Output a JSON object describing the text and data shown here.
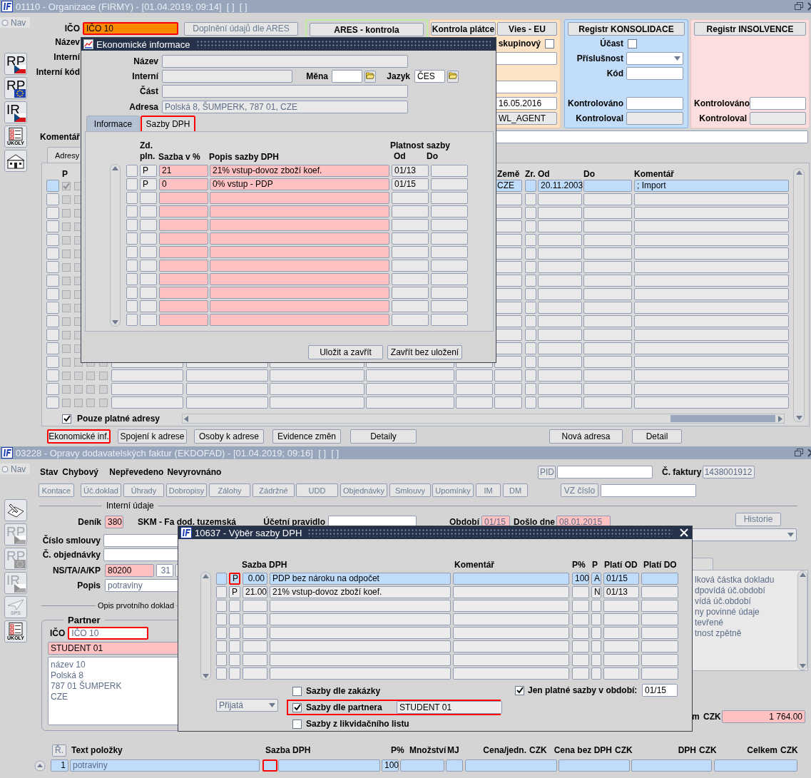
{
  "org_window": {
    "title": "01110 - Organizace (FIRMY) - [01.04.2019; 09:14]  [ ]  [ ]",
    "nav": "Nav",
    "toolbar": [
      {
        "kind": "cz-badge",
        "label": "RP",
        "disabled": false
      },
      {
        "kind": "eu-badge",
        "label": "RP",
        "disabled": false
      },
      {
        "kind": "cz-badge",
        "label": "IR",
        "disabled": false
      },
      {
        "kind": "tasks",
        "label": "ÚKOLY",
        "disabled": false
      },
      {
        "kind": "building",
        "disabled": false
      }
    ],
    "ico": {
      "label": "IČO",
      "value": "IČO 10",
      "highlighted": true
    },
    "labels": [
      "Název",
      "Interní",
      "Interní kód"
    ],
    "fill_button": "Doplnění údajů dle ARES",
    "ares_button": "ARES - kontrola",
    "payer": {
      "buttons": [
        "Kontrola plátce",
        "Vies - EU"
      ],
      "group_label": "skupinový",
      "group_checked": false,
      "checked_date": "16.05.2016",
      "checked_by": "WL_AGENT"
    },
    "consolidation": {
      "button": "Registr KONSOLIDACE",
      "participation": "Účast",
      "participation_checked": false,
      "membership": "Příslušnost",
      "code": "Kód",
      "checked_label": "Kontrolováno",
      "checked_by_label": "Kontroloval"
    },
    "insolvency": {
      "button": "Registr INSOLVENCE",
      "checked_label": "Kontrolováno",
      "checked_by_label": "Kontroloval"
    },
    "comment_label": "Komentář",
    "addresses_tab": "Adresy",
    "address_columns": {
      "p": "P",
      "country": "Země",
      "zr": "Zr.",
      "from": "Od",
      "to": "Do",
      "comment": "Komentář"
    },
    "address_rows": [
      {
        "selected": true,
        "p_checked": true,
        "country": "CZE",
        "from": "20.11.2003",
        "comment": "; Import"
      }
    ],
    "valid_only": {
      "label": "Pouze platné adresy",
      "checked": true
    },
    "buttons": [
      {
        "label": "Ekonomické inf.",
        "highlighted": true
      },
      {
        "label": "Spojení k adrese",
        "highlighted": false
      },
      {
        "label": "Osoby k adrese",
        "highlighted": false
      },
      {
        "label": "Evidence změn",
        "highlighted": false
      },
      {
        "label": "Detaily",
        "highlighted": false
      },
      {
        "label": "Nová adresa",
        "highlighted": false
      },
      {
        "label": "Detail",
        "highlighted": false
      }
    ]
  },
  "econ_dialog": {
    "title": "Ekonomické informace",
    "name_label": "Název",
    "internal_label": "Interní",
    "currency_label": "Měna",
    "language_label": "Jazyk",
    "language": "ČES",
    "part_label": "Část",
    "address_label": "Adresa",
    "address": "Polská 8, ŠUMPERK, 787 01, CZE",
    "tabs": [
      {
        "label": "Informace",
        "selected": false,
        "highlighted": false
      },
      {
        "label": "Sazby DPH",
        "selected": true,
        "highlighted": true
      }
    ],
    "columns": {
      "taxable": "Zd. pln.",
      "rate": "Sazba v %",
      "description": "Popis sazby DPH",
      "validity": "Platnost sazby",
      "from": "Od",
      "to": "Do"
    },
    "rows": [
      {
        "taxable": "P",
        "rate": "21",
        "description": "21% vstup-dovoz zboží koef.",
        "from": "01/13"
      },
      {
        "taxable": "P",
        "rate": "0",
        "description": "0% vstup - PDP",
        "from": "01/15"
      }
    ],
    "buttons": [
      "Uložit a zavřít",
      "Zavřít bez uložení"
    ]
  },
  "invoice_window": {
    "title": "03228 - Opravy dodavatelských faktur (EKDOFAD) - [01.04.2019; 09:16]  [ ]  [ ]",
    "nav": "Nav",
    "toolbar": [
      {
        "kind": "signature",
        "disabled": false
      },
      {
        "kind": "cz-badge",
        "label": "RP",
        "disabled": true
      },
      {
        "kind": "eu-badge",
        "label": "RP",
        "disabled": true
      },
      {
        "kind": "cz-badge",
        "label": "IR",
        "disabled": true
      },
      {
        "kind": "plane",
        "label": "SPS",
        "disabled": true
      },
      {
        "kind": "tasks",
        "label": "ÚKOLY",
        "disabled": false
      }
    ],
    "status": {
      "label": "Stav",
      "value": "Chybový",
      "transfer": "Nepřevedeno",
      "balance": "Nevyrovnáno"
    },
    "pid_button": "PID",
    "invoice_label": "Č. faktury",
    "invoice_no": "1438001912",
    "actions": [
      {
        "label": "Kontace",
        "disabled": true
      },
      {
        "label": "Úč.doklad",
        "disabled": true
      },
      {
        "label": "Úhrady",
        "disabled": true
      },
      {
        "label": "Dobropisy",
        "disabled": true
      },
      {
        "label": "Zálohy",
        "disabled": true
      },
      {
        "label": "Zádržné",
        "disabled": true
      },
      {
        "label": "UDD",
        "disabled": true
      },
      {
        "label": "Objednávky",
        "disabled": true
      },
      {
        "label": "Smlouvy",
        "disabled": true
      },
      {
        "label": "Upomínky",
        "disabled": true
      },
      {
        "label": "IM",
        "disabled": true
      },
      {
        "label": "DM",
        "disabled": true
      }
    ],
    "vz_button": "VZ číslo",
    "internal_section": "Interní údaje",
    "journal_label": "Deník",
    "journal": "380",
    "journal_name": "SKM - Fa dod. tuzemská",
    "rule_label": "Účetní pravidlo",
    "period_label": "Období",
    "period": "01/15",
    "received_label": "Došlo dne",
    "received": "08.01.2015",
    "history_button": "Historie",
    "contract_label": "Číslo smlouvy",
    "order_label": "Č. objednávky",
    "ns_label": "NS/TA/A/KP",
    "ns": "80200",
    "ta": "31",
    "desc_label": "Popis",
    "desc": "potraviny",
    "original_section": "Opis prvotního doklad",
    "partner": {
      "title": "Partner",
      "ico_label": "IČO",
      "ico": "IČO 10",
      "ico_highlighted": true,
      "name": "STUDENT 01",
      "address": [
        "název 10",
        "Polská 8",
        "787 01 ŠUMPERK",
        "CZE"
      ]
    },
    "messages": [
      "lková částka dokladu",
      "dpovídá úč.období",
      "vídá úč.období",
      "ny povinné údaje",
      "tevřené",
      "tnost zpětně"
    ],
    "total": {
      "label": "m",
      "currency": "CZK",
      "value": "1 764.00"
    },
    "item_columns": [
      {
        "label": "Ř."
      },
      {
        "label": "Text položky"
      },
      {
        "label": "Sazba DPH"
      },
      {
        "label": "P%"
      },
      {
        "label": "Množství"
      },
      {
        "label": "MJ"
      },
      {
        "label": "Cena/jedn.",
        "currency": "CZK"
      },
      {
        "label": "Cena bez DPH",
        "currency": "CZK"
      },
      {
        "label": "DPH",
        "currency": "CZK"
      },
      {
        "label": "Celkem",
        "currency": "CZK"
      }
    ],
    "item_rows": [
      {
        "selected": true,
        "no": "1",
        "text": "potraviny",
        "rate_highlighted": true,
        "percent": "100"
      }
    ]
  },
  "rate_dialog": {
    "title": "10637 - Výběr sazby DPH",
    "columns": {
      "rate": "Sazba DPH",
      "comment": "Komentář",
      "percent": "P%",
      "type": "P",
      "from": "Platí OD",
      "to": "Platí DO"
    },
    "rows": [
      {
        "selected": true,
        "p": "P",
        "p_highlighted": true,
        "rate": "0.00",
        "description": "PDP bez nároku na odpočet",
        "percent": "100",
        "type": "A",
        "from": "01/15"
      },
      {
        "selected": false,
        "p": "P",
        "p_highlighted": false,
        "rate": "21.00",
        "description": "21% vstup-dovoz zboží koef.",
        "type": "N",
        "from": "01/13"
      }
    ],
    "direction": {
      "value": "Přijatá",
      "disabled": true
    },
    "options": [
      {
        "label": "Sazby dle zakázky",
        "checked": false,
        "highlighted": false
      },
      {
        "label": "Sazby dle partnera",
        "checked": true,
        "highlighted": true,
        "value": "STUDENT 01"
      },
      {
        "label": "Sazby z likvidačního listu",
        "checked": false,
        "highlighted": false
      }
    ],
    "valid_in_period": {
      "label": "Jen platné sazby v období:",
      "checked": true,
      "value": "01/15"
    }
  }
}
